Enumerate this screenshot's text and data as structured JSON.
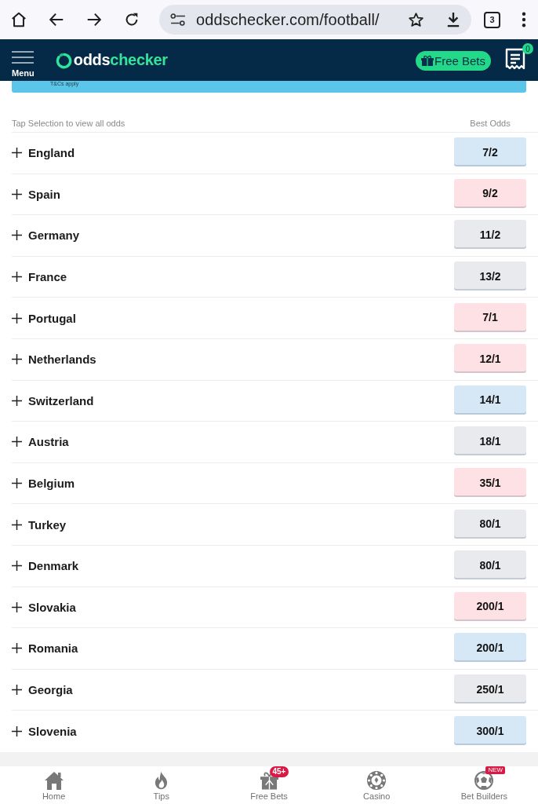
{
  "browser": {
    "url": "oddschecker.com/football/",
    "tab_count": "3"
  },
  "header": {
    "menu_label": "Menu",
    "logo": [
      "odds",
      "checker"
    ],
    "free_bets": "Free Bets",
    "betslip_count": "0"
  },
  "banner": {
    "text": "T&Cs apply"
  },
  "table": {
    "columns": [
      "Tap Selection to view all odds",
      "Best Odds"
    ],
    "rows": [
      {
        "name": "England",
        "odds": "7/2",
        "color": "#d6e8f6"
      },
      {
        "name": "Spain",
        "odds": "9/2",
        "color": "#fde1e5"
      },
      {
        "name": "Germany",
        "odds": "11/2",
        "color": "#e8eaed"
      },
      {
        "name": "France",
        "odds": "13/2",
        "color": "#e8eaed"
      },
      {
        "name": "Portugal",
        "odds": "7/1",
        "color": "#fde1e5"
      },
      {
        "name": "Netherlands",
        "odds": "12/1",
        "color": "#fde1e5"
      },
      {
        "name": "Switzerland",
        "odds": "14/1",
        "color": "#d6e8f6"
      },
      {
        "name": "Austria",
        "odds": "18/1",
        "color": "#e8eaed"
      },
      {
        "name": "Belgium",
        "odds": "35/1",
        "color": "#fde1e5"
      },
      {
        "name": "Turkey",
        "odds": "80/1",
        "color": "#e8eaed"
      },
      {
        "name": "Denmark",
        "odds": "80/1",
        "color": "#e8eaed"
      },
      {
        "name": "Slovakia",
        "odds": "200/1",
        "color": "#fde1e5"
      },
      {
        "name": "Romania",
        "odds": "200/1",
        "color": "#d6e8f6"
      },
      {
        "name": "Georgia",
        "odds": "250/1",
        "color": "#e8eaed"
      },
      {
        "name": "Slovenia",
        "odds": "300/1",
        "color": "#d6e8f6"
      }
    ]
  },
  "bottom_nav": [
    {
      "label": "Home",
      "kind": "home"
    },
    {
      "label": "Tips",
      "kind": "flame"
    },
    {
      "label": "Free Bets",
      "kind": "gift",
      "badge": "45+"
    },
    {
      "label": "Casino",
      "kind": "chip"
    },
    {
      "label": "Bet Builders",
      "kind": "ball",
      "badge": "NEW"
    }
  ]
}
